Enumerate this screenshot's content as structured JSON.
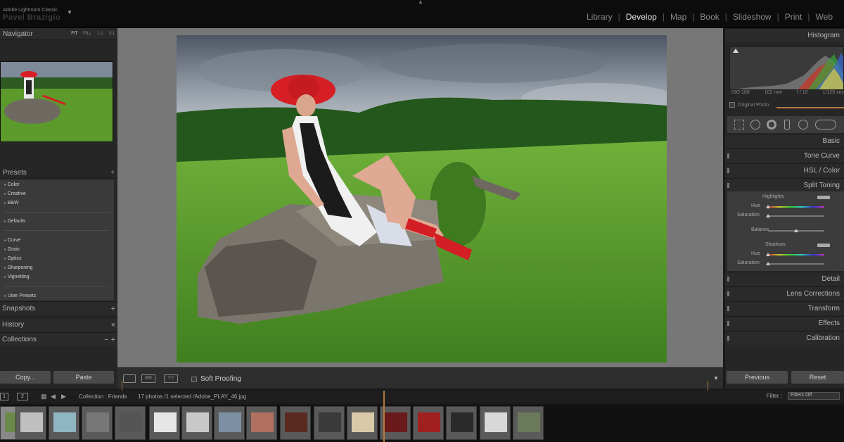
{
  "app": {
    "name": "Adobe Lightroom Classic",
    "identity_plate": "Pavel Brazigio"
  },
  "modules": [
    {
      "label": "Library",
      "active": false
    },
    {
      "label": "Develop",
      "active": true
    },
    {
      "label": "Map",
      "active": false
    },
    {
      "label": "Book",
      "active": false
    },
    {
      "label": "Slideshow",
      "active": false
    },
    {
      "label": "Print",
      "active": false
    },
    {
      "label": "Web",
      "active": false
    }
  ],
  "left_panel": {
    "navigator": {
      "title": "Navigator",
      "options": [
        "FIT",
        "FILL",
        "1:1",
        "3:1"
      ]
    },
    "presets": {
      "title": "Presets",
      "add": "+",
      "groups": [
        [
          "Color",
          "Creative",
          "B&W"
        ],
        [
          "Defaults"
        ],
        [
          "Curve",
          "Grain",
          "Optics",
          "Sharpening",
          "Vignetting"
        ],
        [
          "User Presets"
        ]
      ]
    },
    "snapshots": {
      "title": "Snapshots",
      "action": "+"
    },
    "history": {
      "title": "History",
      "action": "×"
    },
    "collections": {
      "title": "Collections",
      "action": "− +"
    },
    "copy_label": "Copy...",
    "paste_label": "Paste"
  },
  "toolbar": {
    "soft_proofing": "Soft Proofing",
    "view_labels": [
      "RR",
      "YY"
    ]
  },
  "right_panel": {
    "histogram": {
      "title": "Histogram",
      "iso": "ISO 100",
      "focal": "102 mm",
      "aperture": "f / 10",
      "shutter": "1/125 sec"
    },
    "original_photo": "Original Photo",
    "sections": [
      "Basic",
      "Tone Curve",
      "HSL / Color",
      "Split Toning",
      "Detail",
      "Lens Corrections",
      "Transform",
      "Effects",
      "Calibration"
    ],
    "split_toning": {
      "highlights": "Highlights",
      "hue": "Hue",
      "saturation": "Saturation",
      "balance": "Balance",
      "shadows": "Shadows",
      "hue2": "Hue",
      "saturation2": "Saturation"
    },
    "previous_label": "Previous",
    "reset_label": "Reset"
  },
  "filmstrip": {
    "screen1": "1",
    "screen2": "2",
    "source": "Collection : Friends",
    "info": "17 photos /1 selected /Adobe_PLAY_46.jpg",
    "filter_label": "Filter :",
    "filter_value": "Filters Off"
  },
  "colors": {
    "accent_orange": "#b07a3e",
    "active_module": "#e9e9e9",
    "panel_bg": "#262626",
    "center_bg": "#777777"
  }
}
